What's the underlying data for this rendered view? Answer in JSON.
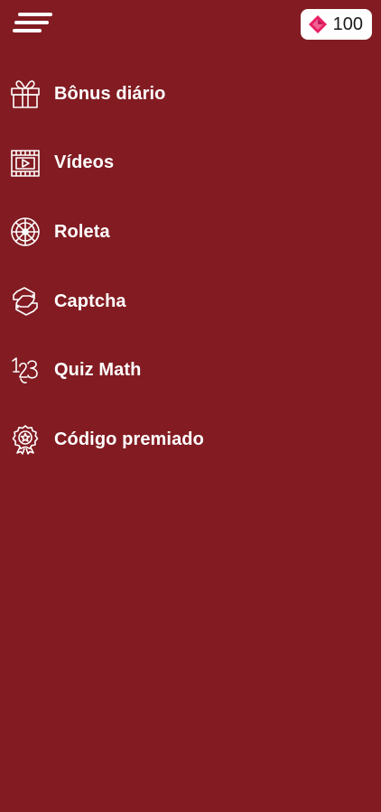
{
  "header": {
    "menu_icon": "hamburger-menu-icon",
    "points": {
      "icon": "pink-gem-icon",
      "value": "100"
    }
  },
  "menu": {
    "items": [
      {
        "label": "Bônus diário",
        "icon": "gift-icon"
      },
      {
        "label": "Vídeos",
        "icon": "video-film-icon"
      },
      {
        "label": "Roleta",
        "icon": "roulette-wheel-icon"
      },
      {
        "label": "Captcha",
        "icon": "captcha-icon"
      },
      {
        "label": "Quiz Math",
        "icon": "math-numbers-icon"
      },
      {
        "label": "Código premiado",
        "icon": "award-badge-icon"
      }
    ]
  },
  "colors": {
    "background": "#821c22",
    "text": "#ffffff",
    "badge_background": "#ffffff",
    "gem": "#e91e63"
  }
}
